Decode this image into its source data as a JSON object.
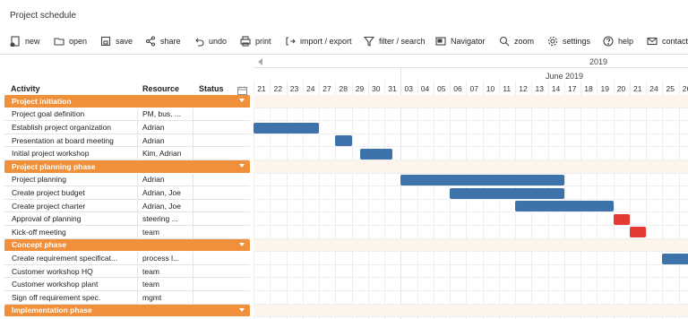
{
  "app": {
    "title": "Project schedule"
  },
  "toolbar": {
    "items": [
      {
        "label": "new",
        "icon": "new-document-icon"
      },
      {
        "label": "open",
        "icon": "folder-icon"
      },
      {
        "label": "save",
        "icon": "save-icon"
      },
      {
        "label": "share",
        "icon": "share-icon"
      },
      {
        "label": "undo",
        "icon": "undo-icon"
      },
      {
        "label": "print",
        "icon": "printer-icon"
      },
      {
        "label": "import / export",
        "icon": "import-export-icon"
      },
      {
        "label": "filter / search",
        "icon": "filter-icon"
      },
      {
        "label": "Navigator",
        "icon": "navigator-icon"
      },
      {
        "label": "zoom",
        "icon": "zoom-icon"
      },
      {
        "label": "settings",
        "icon": "gear-icon"
      },
      {
        "label": "help",
        "icon": "help-icon"
      },
      {
        "label": "contact",
        "icon": "mail-icon"
      }
    ]
  },
  "table": {
    "headers": {
      "activity": "Activity",
      "resource": "Resource",
      "status": "Status"
    },
    "rows": [
      {
        "type": "phase",
        "activity": "Project initiation",
        "resource": ""
      },
      {
        "type": "task",
        "activity": "Project goal definition",
        "resource": "PM, bus. ..."
      },
      {
        "type": "task",
        "activity": "Establish project organization",
        "resource": "Adrian"
      },
      {
        "type": "task",
        "activity": "Presentation at board meeting",
        "resource": "Adrian"
      },
      {
        "type": "task",
        "activity": "Initial project workshop",
        "resource": "Kim, Adrian"
      },
      {
        "type": "phase",
        "activity": "Project planning phase",
        "resource": ""
      },
      {
        "type": "task",
        "activity": "Project planning",
        "resource": "Adrian"
      },
      {
        "type": "task",
        "activity": "Create project budget",
        "resource": "Adrian, Joe"
      },
      {
        "type": "task",
        "activity": "Create project charter",
        "resource": "Adrian, Joe"
      },
      {
        "type": "task",
        "activity": "Approval of planning",
        "resource": "steering ..."
      },
      {
        "type": "task",
        "activity": "Kick-off meeting",
        "resource": "team"
      },
      {
        "type": "phase",
        "activity": "Concept phase",
        "resource": ""
      },
      {
        "type": "task",
        "activity": "Create requirement specificat...",
        "resource": "process l..."
      },
      {
        "type": "task",
        "activity": "Customer workshop HQ",
        "resource": "team"
      },
      {
        "type": "task",
        "activity": "Customer workshop plant",
        "resource": "team"
      },
      {
        "type": "task",
        "activity": "Sign off requirement spec.",
        "resource": "mgmt"
      },
      {
        "type": "phase",
        "activity": "Implementation phase",
        "resource": ""
      }
    ]
  },
  "timeline": {
    "year": "2019",
    "month": "June 2019",
    "days": [
      "21",
      "22",
      "23",
      "24",
      "27",
      "28",
      "29",
      "30",
      "31",
      "03",
      "04",
      "05",
      "06",
      "07",
      "10",
      "11",
      "12",
      "13",
      "14",
      "17",
      "18",
      "19",
      "20",
      "21",
      "24",
      "25",
      "26"
    ]
  },
  "colors": {
    "phase": "#f0903a",
    "bar": "#3d72aa",
    "milestone": "#e53935"
  },
  "bars": [
    {
      "row": 2,
      "start": 0,
      "end": 4,
      "color": "bar"
    },
    {
      "row": 3,
      "start": 5,
      "end": 6,
      "color": "bar"
    },
    {
      "row": 4,
      "start": 6.5,
      "end": 8.5,
      "color": "bar"
    },
    {
      "row": 6,
      "start": 9,
      "end": 19,
      "color": "bar"
    },
    {
      "row": 7,
      "start": 12,
      "end": 19,
      "color": "bar"
    },
    {
      "row": 8,
      "start": 16,
      "end": 22,
      "color": "bar"
    },
    {
      "row": 9,
      "start": 22,
      "end": 23,
      "color": "milestone"
    },
    {
      "row": 10,
      "start": 23,
      "end": 24,
      "color": "milestone"
    },
    {
      "row": 12,
      "start": 25,
      "end": 27,
      "color": "bar"
    }
  ]
}
